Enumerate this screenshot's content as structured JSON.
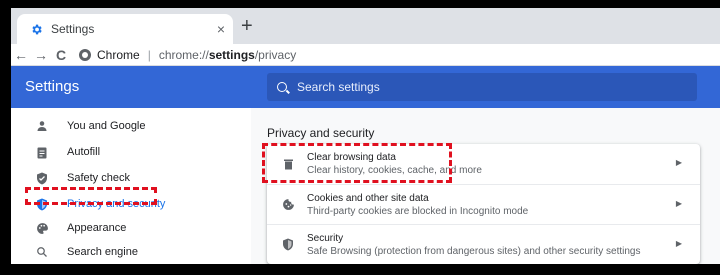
{
  "tab": {
    "title": "Settings",
    "close": "×"
  },
  "newtab": "+",
  "toolbar": {
    "back": "←",
    "forward": "→",
    "reload": "C",
    "chip": "Chrome",
    "separator": "|",
    "url_prefix": "chrome://",
    "url_bold": "settings",
    "url_suffix": "/privacy"
  },
  "header": {
    "title": "Settings",
    "search_placeholder": "Search settings"
  },
  "sidebar": {
    "items": [
      {
        "label": "You and Google",
        "icon": "person-icon"
      },
      {
        "label": "Autofill",
        "icon": "clipboard-icon"
      },
      {
        "label": "Safety check",
        "icon": "shield-check-icon"
      },
      {
        "label": "Privacy and security",
        "icon": "shield-icon"
      },
      {
        "label": "Appearance",
        "icon": "palette-icon"
      },
      {
        "label": "Search engine",
        "icon": "search-icon"
      }
    ]
  },
  "main": {
    "section_title": "Privacy and security",
    "rows": [
      {
        "title": "Clear browsing data",
        "subtitle": "Clear history, cookies, cache, and more",
        "icon": "trash-icon"
      },
      {
        "title": "Cookies and other site data",
        "subtitle": "Third-party cookies are blocked in Incognito mode",
        "icon": "cookie-icon"
      },
      {
        "title": "Security",
        "subtitle": "Safe Browsing (protection from dangerous sites) and other security settings",
        "icon": "security-shield-icon"
      }
    ]
  },
  "colors": {
    "header": "#3367d6",
    "active": "#1a73e8",
    "highlight": "#e0101f"
  }
}
